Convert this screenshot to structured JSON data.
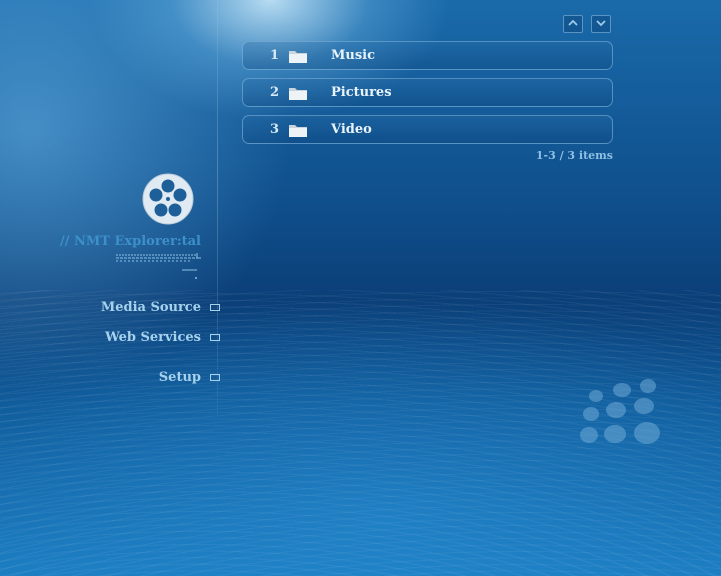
{
  "nav": {
    "scroll_up_icon": "chevron-up-icon",
    "scroll_down_icon": "chevron-down-icon"
  },
  "list": {
    "items": [
      {
        "number": "1",
        "label": "Music",
        "icon": "folder-icon"
      },
      {
        "number": "2",
        "label": "Pictures",
        "icon": "folder-icon"
      },
      {
        "number": "3",
        "label": "Video",
        "icon": "folder-icon"
      }
    ],
    "count": "1-3 / 3 items"
  },
  "sidebar": {
    "icon": "film-reel-icon",
    "title": "// NMT Explorer:tal",
    "menu": [
      {
        "label": "Media Source"
      },
      {
        "label": "Web Services"
      },
      {
        "label": "Setup"
      }
    ]
  },
  "brand": {
    "logo": "dot-cluster-logo"
  },
  "colors": {
    "accent": "#3d90c9",
    "menu_text": "#a6d2ee",
    "list_text": "#e8f3fb",
    "background_dark": "#0b3f78"
  }
}
